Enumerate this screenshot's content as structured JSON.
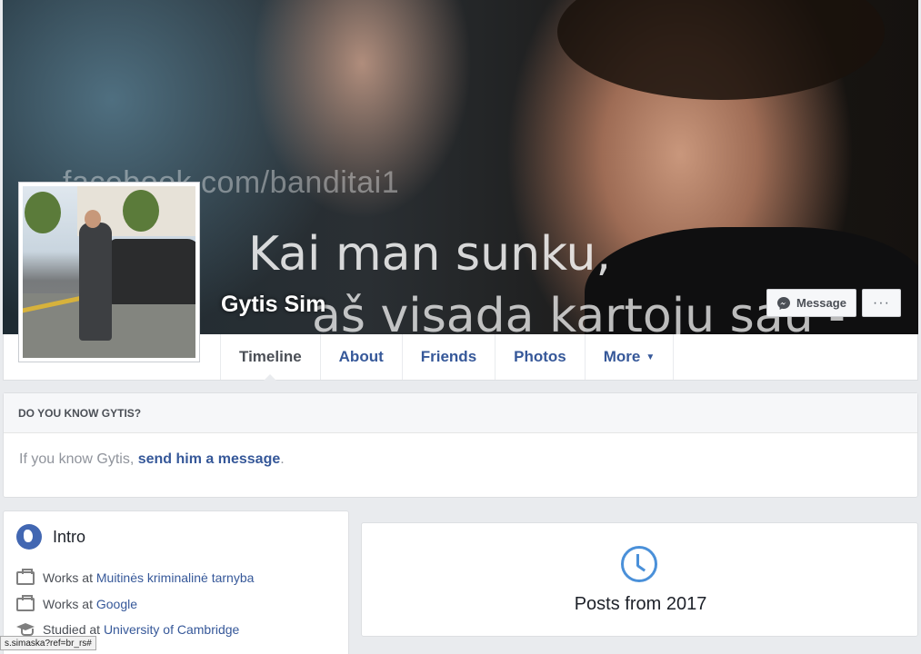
{
  "cover": {
    "watermark": "facebook.com/banditai1",
    "quote_line1": "Kai man sunku,",
    "quote_line2": "aš visada kartoju sau -"
  },
  "profile": {
    "name": "Gytis Sim"
  },
  "actions": {
    "message_label": "Message",
    "more_label": "···"
  },
  "nav": {
    "tabs": [
      {
        "label": "Timeline",
        "active": true
      },
      {
        "label": "About"
      },
      {
        "label": "Friends"
      },
      {
        "label": "Photos"
      },
      {
        "label": "More"
      }
    ]
  },
  "know": {
    "heading": "DO YOU KNOW GYTIS?",
    "prefix": "If you know Gytis, ",
    "link": "send him a message",
    "suffix": "."
  },
  "intro": {
    "title": "Intro",
    "items": [
      {
        "prefix": "Works at ",
        "link": "Muitinės kriminalinė tarnyba",
        "icon": "briefcase-icon"
      },
      {
        "prefix": "Works at ",
        "link": "Google",
        "icon": "briefcase-icon"
      },
      {
        "prefix": "Studied at ",
        "link": "University of Cambridge",
        "icon": "graduation-cap-icon"
      }
    ]
  },
  "posts": {
    "label": "Posts from 2017"
  },
  "status_bar": {
    "url": "s.simaska?ref=br_rs#"
  },
  "colors": {
    "link": "#365899",
    "accent": "#4267b2",
    "background": "#e9ebee"
  }
}
